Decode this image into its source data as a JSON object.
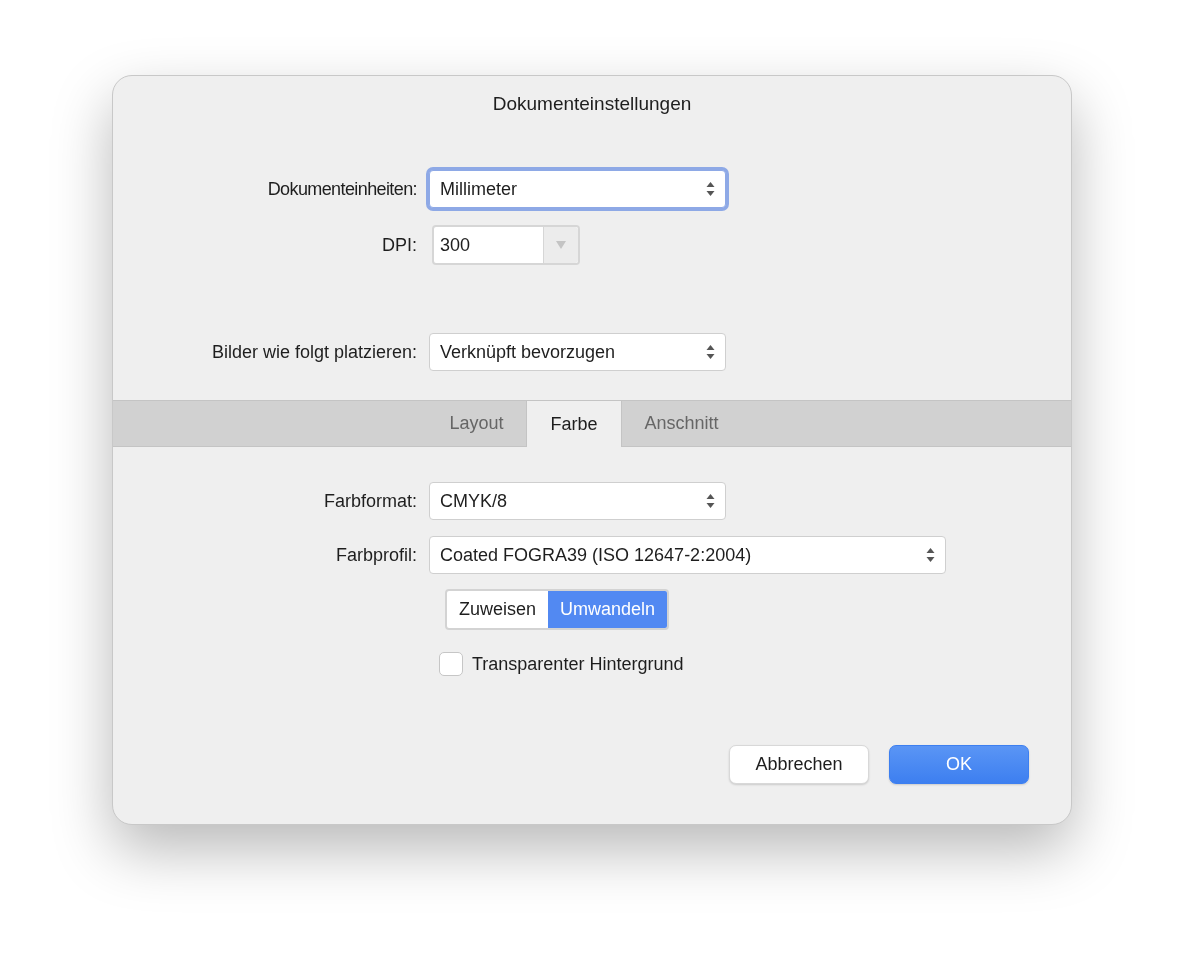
{
  "window": {
    "title": "Dokumenteinstellungen"
  },
  "document_fields": [
    {
      "kind": "select",
      "label": "Dokumenteinheiten:",
      "value": "Millimeter",
      "focused": true
    },
    {
      "kind": "combo",
      "label": "DPI:",
      "value": "300",
      "focused": false
    },
    {
      "kind": "select",
      "label": "Bilder wie folgt platzieren:",
      "value": "Verknüpft bevorzugen",
      "focused": false
    }
  ],
  "tabs": [
    {
      "label": "Layout",
      "selected": false
    },
    {
      "label": "Farbe",
      "selected": true
    },
    {
      "label": "Anschnitt",
      "selected": false
    }
  ],
  "color_fields": [
    {
      "kind": "select",
      "label": "Farbformat:",
      "value": "CMYK/8",
      "focused": false
    },
    {
      "kind": "select",
      "label": "Farbprofil:",
      "value": "Coated FOGRA39 (ISO 12647-2:2004)",
      "focused": false
    }
  ],
  "segments": [
    {
      "label": "Zuweisen",
      "selected": false
    },
    {
      "label": "Umwandeln",
      "selected": true
    }
  ],
  "checkbox": {
    "label": "Transparenter Hintergrund",
    "checked": false
  },
  "buttons": [
    {
      "label": "Abbrechen",
      "kind": "normal"
    },
    {
      "label": "OK",
      "kind": "default"
    }
  ]
}
